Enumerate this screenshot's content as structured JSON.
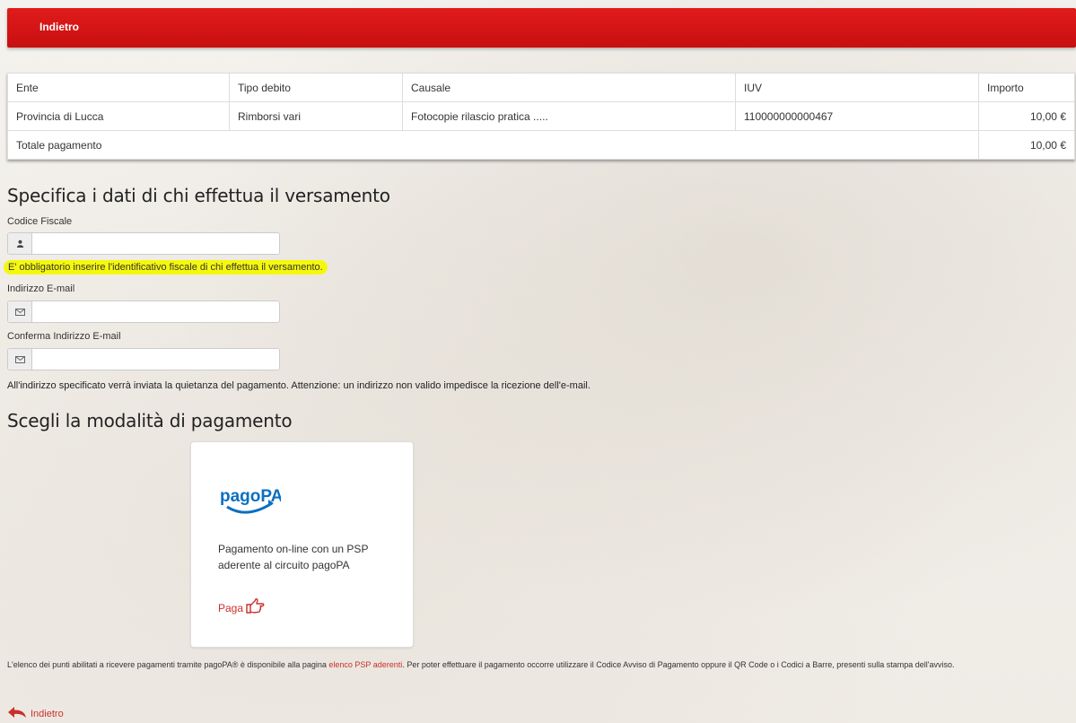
{
  "header": {
    "back_label": "Indietro"
  },
  "table": {
    "columns": [
      "Ente",
      "Tipo debito",
      "Causale",
      "IUV",
      "Importo"
    ],
    "rows": [
      {
        "ente": "Provincia di Lucca",
        "tipo_debito": "Rimborsi vari",
        "causale": "Fotocopie rilascio pratica .....",
        "iuv": "110000000000467",
        "importo": "10,00 €"
      }
    ],
    "total_label": "Totale pagamento",
    "total_value": "10,00 €"
  },
  "payer": {
    "title": "Specifica i dati di chi effettua il versamento",
    "codice_fiscale_label": "Codice Fiscale",
    "codice_fiscale_value": "",
    "codice_fiscale_error": "E' obbligatorio inserire l'identificativo fiscale di chi effettua il versamento.",
    "email_label": "Indirizzo E-mail",
    "email_value": "",
    "email_confirm_label": "Conferma Indirizzo E-mail",
    "email_confirm_value": "",
    "email_note": "All'indirizzo specificato verrà inviata la quietanza del pagamento. Attenzione: un indirizzo non valido impedisce la ricezione dell'e-mail."
  },
  "payment": {
    "title": "Scegli la modalità di pagamento",
    "logo_text": "pagoPA",
    "description": "Pagamento on-line con un PSP aderente al circuito pagoPA",
    "pay_label": "Paga"
  },
  "footer": {
    "text_before_link": "L'elenco dei punti abilitati a ricevere pagamenti tramite pagoPA® è disponibile alla pagina ",
    "link_text": "elenco PSP aderenti",
    "text_after_link": ". Per poter effettuare il pagamento occorre utilizzare il Codice Avviso di Pagamento oppure il QR Code o i Codici a Barre, presenti sulla stampa dell'avviso.",
    "back_label": "Indietro"
  },
  "colors": {
    "brand_red": "#d41414",
    "link_red": "#c9302c",
    "highlight": "#f5f80c",
    "pagopa_blue": "#0b6fc0"
  }
}
